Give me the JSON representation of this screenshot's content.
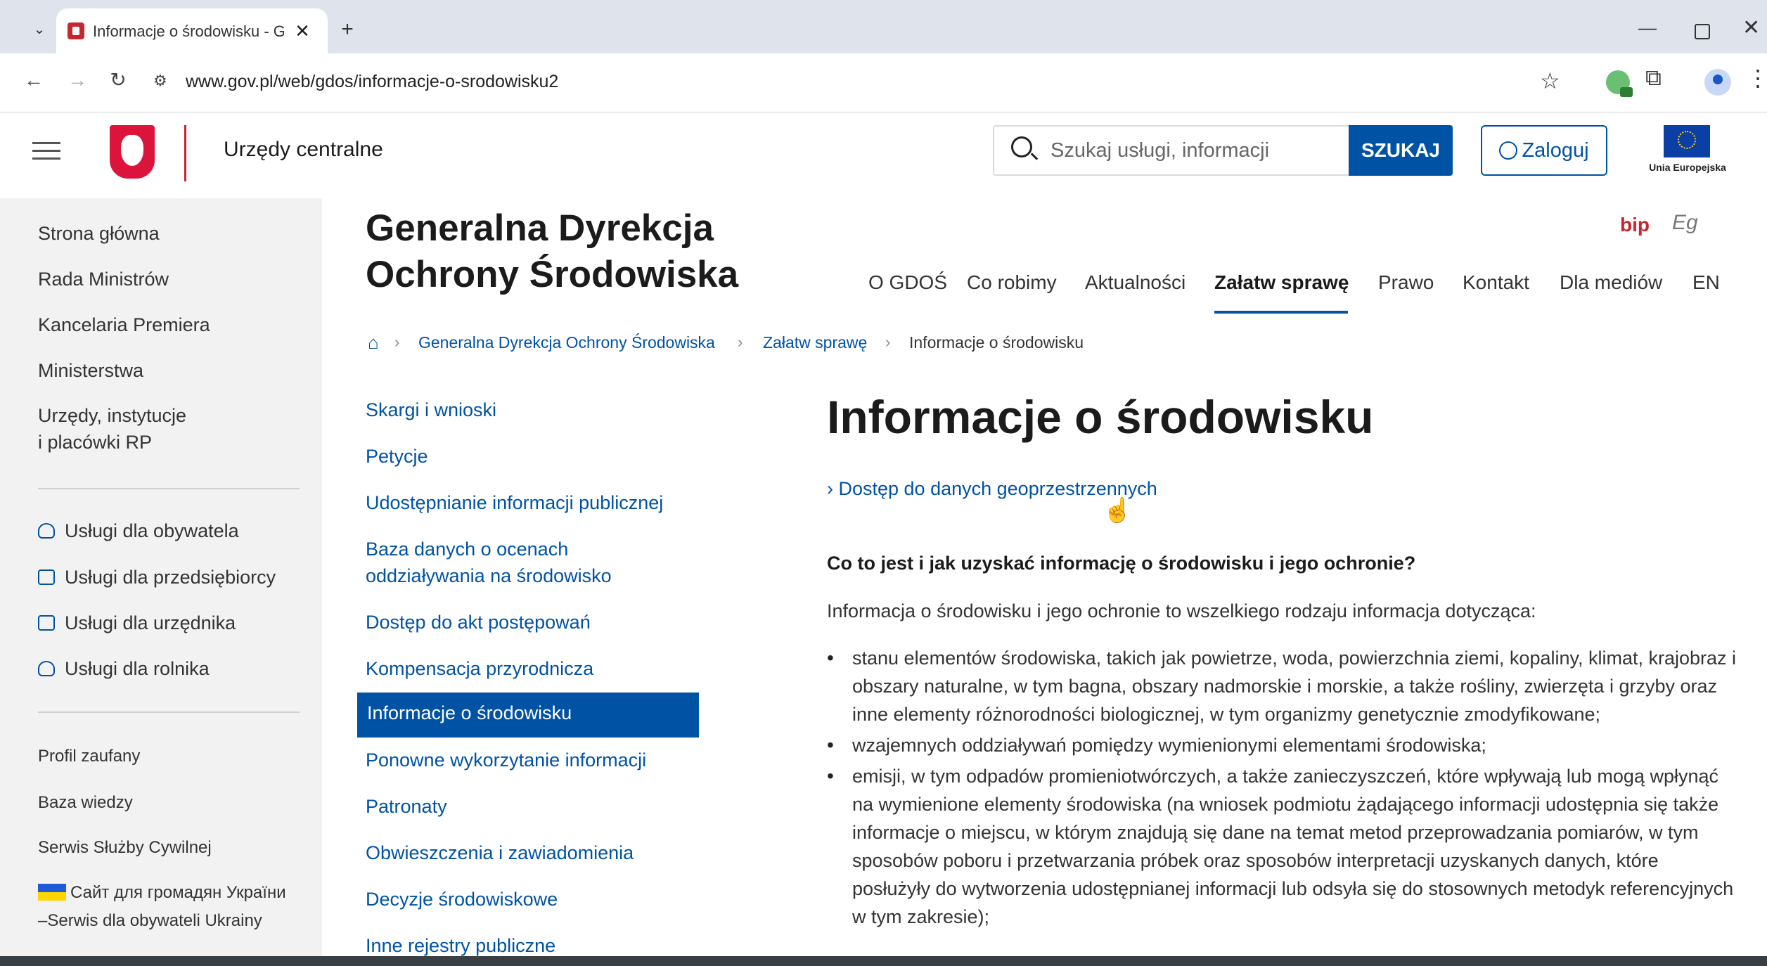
{
  "browser": {
    "tab_title": "Informacje o środowisku - Gen",
    "url": "www.gov.pl/web/gdos/informacje-o-srodowisku2"
  },
  "header": {
    "site_name": "Urzędy centralne",
    "search_placeholder": "Szukaj usługi, informacji",
    "search_button": "SZUKAJ",
    "login_button": "Zaloguj",
    "eu_label": "Unia Europejska"
  },
  "gov_sidebar": {
    "main_links": [
      "Strona główna",
      "Rada Ministrów",
      "Kancelaria Premiera",
      "Ministerstwa",
      "Urzędy, instytucje",
      "i placówki RP"
    ],
    "services": [
      "Usługi dla obywatela",
      "Usługi dla przedsiębiorcy",
      "Usługi dla urzędnika",
      "Usługi dla rolnika"
    ],
    "extra_links": [
      "Profil zaufany",
      "Baza wiedzy",
      "Serwis Służby Cywilnej"
    ],
    "ukraine_line1": "Сайт для громадян України",
    "ukraine_line2": "–Serwis dla obywateli Ukrainy"
  },
  "org": {
    "title_line1": "Generalna Dyrekcja",
    "title_line2": "Ochrony Środowiska",
    "bip": "bip",
    "eg": "Eg"
  },
  "top_nav": [
    "O GDOŚ",
    "Co robimy",
    "Aktualności",
    "Załatw sprawę",
    "Prawo",
    "Kontakt",
    "Dla mediów",
    "EN"
  ],
  "breadcrumb": [
    "Generalna Dyrekcja Ochrony Środowiska",
    "Załatw sprawę",
    "Informacje o środowisku"
  ],
  "sub_nav": [
    "Skargi i wnioski",
    "Petycje",
    "Udostępnianie informacji publicznej",
    "Baza danych o ocenach",
    "oddziaływania na środowisko",
    "Dostęp do akt postępowań",
    "Kompensacja przyrodnicza",
    "Informacje o środowisku",
    "Ponowne wykorzytanie informacji",
    "Patronaty",
    "Obwieszczenia i zawiadomienia",
    "Decyzje środowiskowe",
    "Inne rejestry publiczne"
  ],
  "content": {
    "title": "Informacje o środowisku",
    "geo_link": "› Dostęp do danych geoprzestrzennych",
    "heading": "Co to jest i jak uzyskać informację o środowisku i jego ochronie?",
    "intro": "Informacja o środowisku i jego ochronie to wszelkiego rodzaju informacja dotycząca:",
    "bullets": [
      "stanu elementów środowiska, takich jak powietrze, woda, powierzchnia ziemi, kopaliny, klimat, krajobraz i obszary naturalne, w tym bagna, obszary nadmorskie i morskie, a także rośliny, zwierzęta i grzyby oraz inne elementy różnorodności biologicznej, w tym organizmy genetycznie zmodyfikowane;",
      "wzajemnych oddziaływań pomiędzy wymienionymi elementami środowiska;",
      "emisji, w tym odpadów promieniotwórczych, a także zanieczyszczeń, które wpływają lub mogą wpłynąć na wymienione elementy środowiska (na wniosek podmiotu żądającego informacji udostępnia się także informacje o miejscu, w którym znajdują się dane na temat metod przeprowadzania pomiarów, w tym sposobów poboru i przetwarzania próbek oraz sposobów interpretacji uzyskanych danych, które posłużyły do wytworzenia udostępnianej informacji lub odsyła się do stosownych metodyk referencyjnych w tym zakresie);"
    ]
  }
}
